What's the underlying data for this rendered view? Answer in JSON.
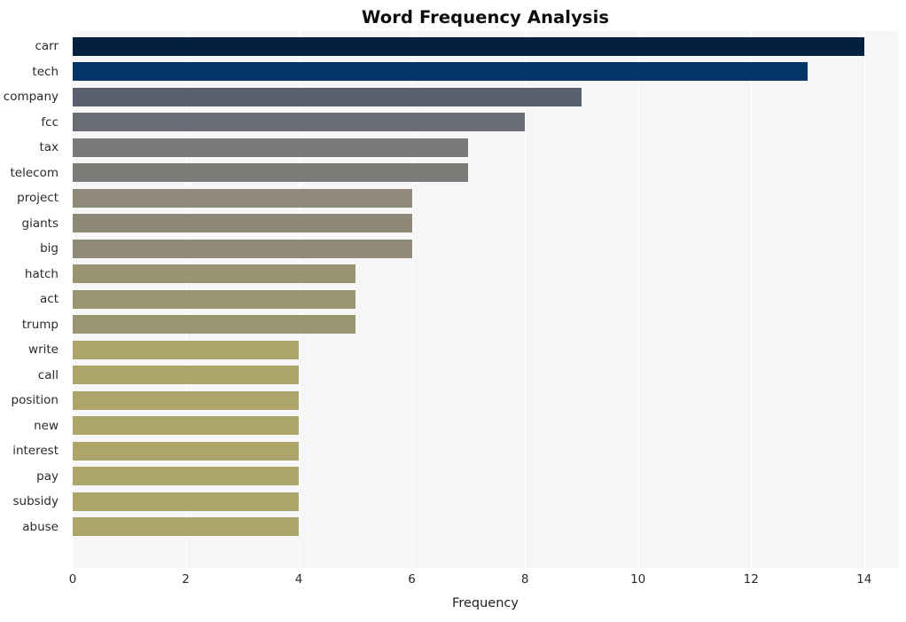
{
  "chart_data": {
    "type": "bar",
    "orientation": "horizontal",
    "title": "Word Frequency Analysis",
    "xlabel": "Frequency",
    "ylabel": "",
    "xlim": [
      0,
      14.6
    ],
    "xticks": [
      0,
      2,
      4,
      6,
      8,
      10,
      12,
      14
    ],
    "xticklabels": [
      "0",
      "2",
      "4",
      "6",
      "8",
      "10",
      "12",
      "14"
    ],
    "grid": true,
    "grid_axis": "x",
    "grid_color": "#ffffff",
    "plot_background": "#f6f6f7",
    "figure_background": "#ffffff",
    "legend": null,
    "categories": [
      "carr",
      "tech",
      "company",
      "fcc",
      "tax",
      "telecom",
      "project",
      "giants",
      "big",
      "hatch",
      "act",
      "trump",
      "write",
      "call",
      "position",
      "new",
      "interest",
      "pay",
      "subsidy",
      "abuse"
    ],
    "values": [
      14,
      13,
      9,
      8,
      7,
      7,
      6,
      6,
      6,
      5,
      5,
      5,
      4,
      4,
      4,
      4,
      4,
      4,
      4,
      4
    ],
    "bar_colors": [
      "#04203f",
      "#033568",
      "#5a6070",
      "#696c72",
      "#7b7a78",
      "#7c7b78",
      "#8e8978",
      "#8e8977",
      "#8f8a77",
      "#9a9371",
      "#9b9470",
      "#9b9470",
      "#ada469",
      "#ada469",
      "#ada469",
      "#ada469",
      "#ada469",
      "#ada469",
      "#ada469",
      "#ada469"
    ],
    "colormap": "cividis_r"
  }
}
